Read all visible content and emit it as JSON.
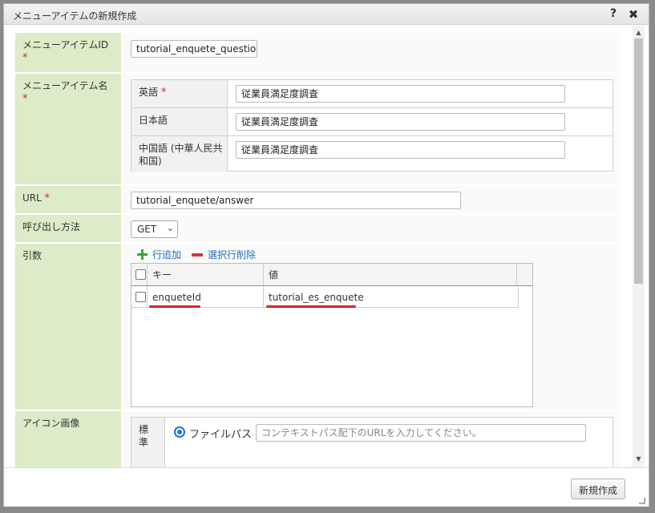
{
  "dialog": {
    "title": "メニューアイテムの新規作成",
    "help_icon": "?",
    "close_icon": "✖"
  },
  "form": {
    "menu_item_id": {
      "label": "メニューアイテムID",
      "required_mark": "*",
      "value": "tutorial_enquete_question"
    },
    "menu_item_name": {
      "label": "メニューアイテム名",
      "required_mark": "*",
      "locales": [
        {
          "label": "英語",
          "required_mark": "*",
          "value": "従業員満足度調査"
        },
        {
          "label": "日本語",
          "value": "従業員満足度調査"
        },
        {
          "label": "中国語 (中華人民共和国)",
          "value": "従業員満足度調査"
        }
      ]
    },
    "url": {
      "label": "URL",
      "required_mark": "*",
      "value": "tutorial_enquete/answer"
    },
    "call_method": {
      "label": "呼び出し方法",
      "selected": "GET"
    },
    "arguments": {
      "label": "引数",
      "add_row_label": "行追加",
      "delete_rows_label": "選択行削除",
      "columns": [
        "キー",
        "値"
      ],
      "rows": [
        {
          "key": "enqueteId",
          "value": "tutorial_es_enquete",
          "checked": false
        }
      ],
      "highlight_color": "#d8232a"
    },
    "icon_image": {
      "label": "アイコン画像",
      "sub_label": "標準",
      "option_label": "ファイルパス",
      "path_placeholder": "コンテキストパス配下のURLを入力してください。"
    }
  },
  "footer": {
    "create_button": "新規作成"
  },
  "colors": {
    "label_bg": "#dcebc8",
    "required": "#d9232d",
    "link": "#1f6fbf",
    "add_icon": "#3da43d",
    "delete_icon": "#d9343a"
  }
}
